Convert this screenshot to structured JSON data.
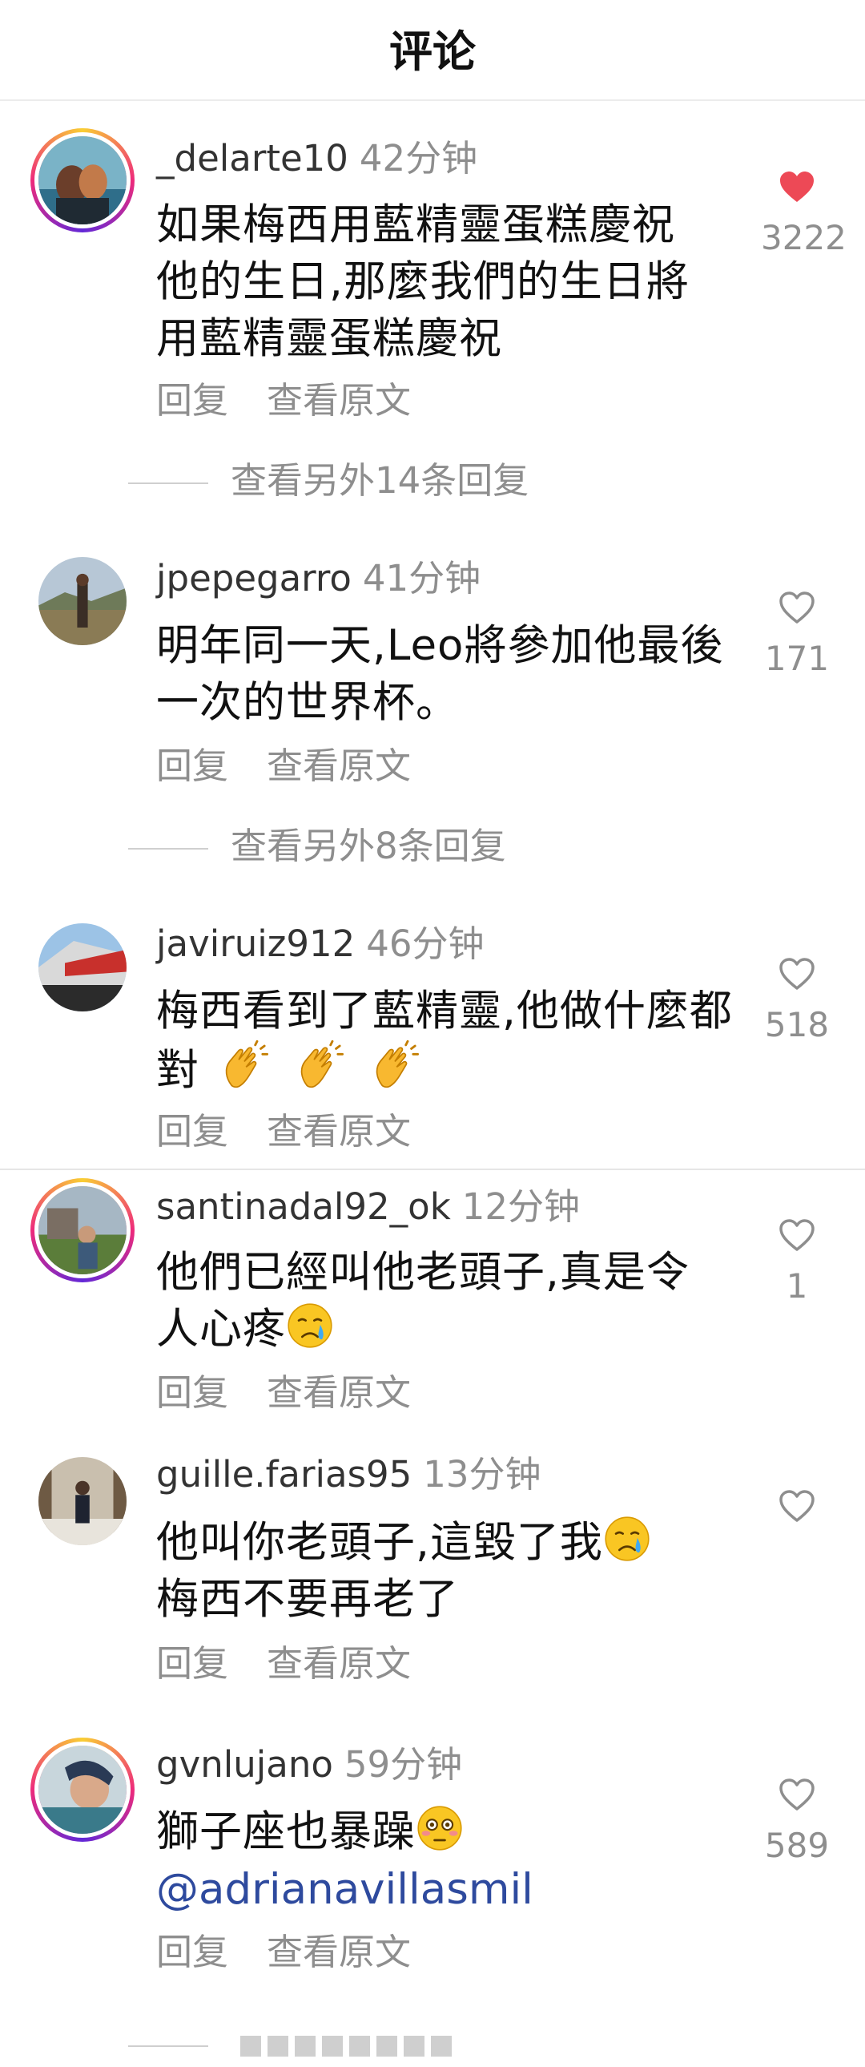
{
  "header": {
    "title": "评论"
  },
  "labels": {
    "reply": "回复",
    "view_original": "查看原文"
  },
  "comments": [
    {
      "username": "_delarte10",
      "time": "42分钟",
      "text": "如果梅西用藍精靈蛋糕慶祝他的生日,那麼我們的生日將用藍精靈蛋糕慶祝",
      "likes": "3222",
      "liked": true,
      "more_replies": "查看另外14条回复"
    },
    {
      "username": "jpepegarro",
      "time": "41分钟",
      "text": "明年同一天,Leo將參加他最後一次的世界杯。",
      "likes": "171",
      "liked": false,
      "more_replies": "查看另外8条回复"
    },
    {
      "username": "javiruiz912",
      "time": "46分钟",
      "text": "梅西看到了藍精靈,他做什麼都對",
      "emoji": "clapping-hands x3",
      "likes": "518",
      "liked": false
    },
    {
      "username": "santinadal92_ok",
      "time": "12分钟",
      "text": "他們已經叫他老頭子,真是令人心疼",
      "emoji": "crying-face",
      "likes": "1",
      "liked": false
    },
    {
      "username": "guille.farias95",
      "time": "13分钟",
      "text_line1": "他叫你老頭子,這毀了我",
      "text_line2": "梅西不要再老了",
      "emoji": "crying-face",
      "likes": "",
      "liked": false
    },
    {
      "username": "gvnlujano",
      "time": "59分钟",
      "text": "獅子座也暴躁",
      "emoji": "flushed-face",
      "mention": "@adrianavillasmil",
      "likes": "589",
      "liked": false
    }
  ],
  "colors": {
    "liked": "#ed4956",
    "mention": "#2e4a9e",
    "meta": "#8e8e8e"
  }
}
